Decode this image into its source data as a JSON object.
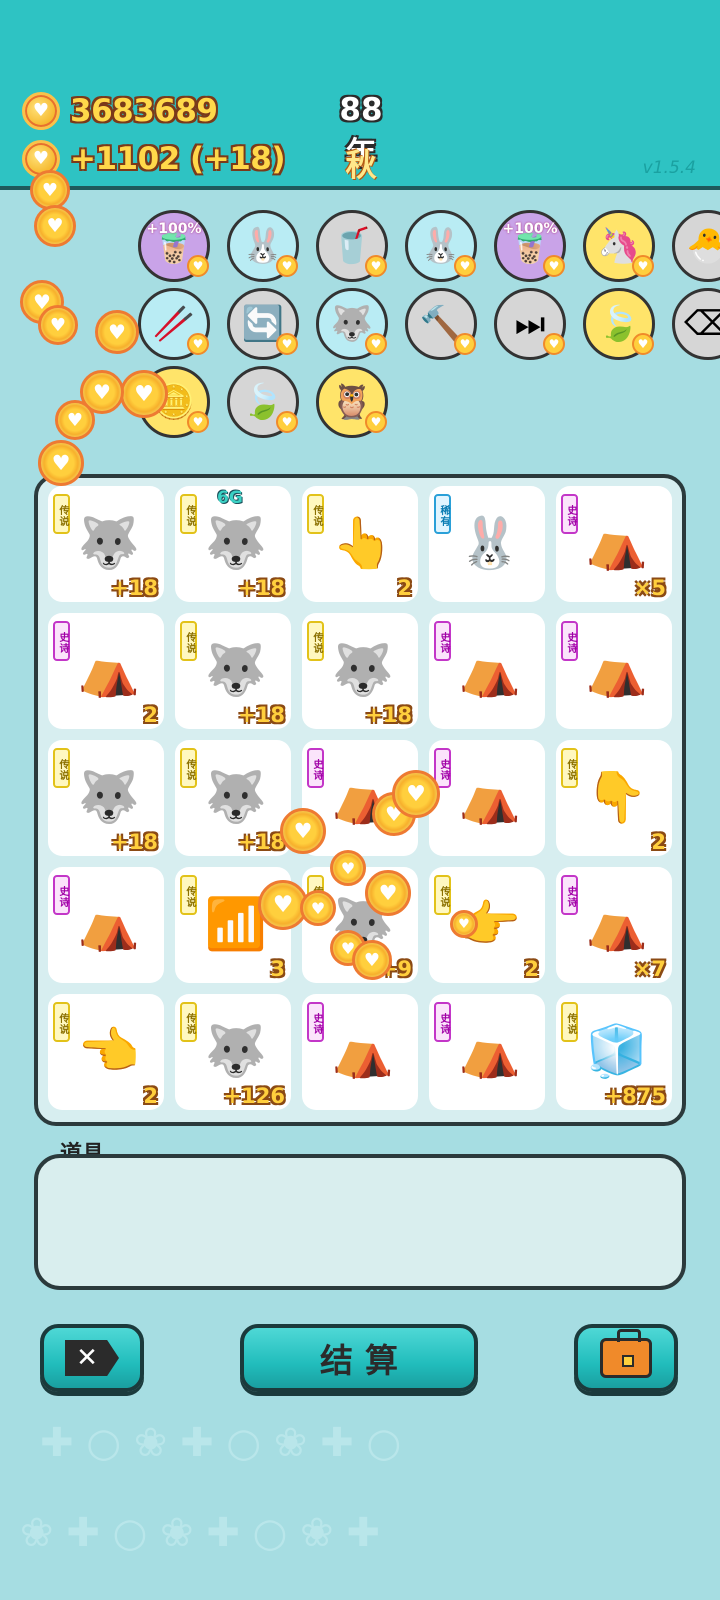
{
  "header": {
    "coins_total": "3683689",
    "income_rate": "+1102 (+18)",
    "year": "88年",
    "season": "秋",
    "version": "v1.5.4"
  },
  "powerups": [
    {
      "name": "boba-tea-boost",
      "icon": "🧋",
      "tag": "+100%",
      "bg": "#c9a3e8"
    },
    {
      "name": "rabbit-buddy",
      "icon": "🐰",
      "bg": "#b9ecf4"
    },
    {
      "name": "bubble-tea-cup",
      "icon": "🥤",
      "bg": "#d6d6d6"
    },
    {
      "name": "rabbit-buddy-2",
      "icon": "🐰",
      "bg": "#b9ecf4"
    },
    {
      "name": "boba-tea-boost-2",
      "icon": "🧋",
      "tag": "+100%",
      "bg": "#c9a3e8"
    },
    {
      "name": "unicorn",
      "icon": "🦄",
      "bg": "#ffe46a"
    },
    {
      "name": "chick-egg",
      "icon": "🐣",
      "bg": "#d6d6d6"
    },
    {
      "name": "chopsticks",
      "icon": "🥢",
      "bg": "#b9ecf4"
    },
    {
      "name": "refresh",
      "icon": "🔄",
      "bg": "#d6d6d6"
    },
    {
      "name": "husky-small",
      "icon": "🐺",
      "bg": "#b9ecf4"
    },
    {
      "name": "hammer",
      "icon": "🔨",
      "bg": "#d6d6d6"
    },
    {
      "name": "skip",
      "icon": "⏭",
      "bg": "#d6d6d6"
    },
    {
      "name": "leaf",
      "icon": "🍃",
      "bg": "#ffe46a"
    },
    {
      "name": "delete-tag",
      "icon": "⌫",
      "bg": "#d6d6d6"
    },
    {
      "name": "gold-coin-boost",
      "icon": "🪙",
      "bg": "#ffe46a"
    },
    {
      "name": "leaf-2",
      "icon": "🍃",
      "bg": "#d6d6d6"
    },
    {
      "name": "owl-glasses",
      "icon": "🦉",
      "bg": "#ffe46a"
    }
  ],
  "board": [
    {
      "rarity": "legend",
      "badge": "传说",
      "sprite": "🐺",
      "bonus": "+18"
    },
    {
      "rarity": "legend",
      "badge": "传说",
      "sprite": "🐺",
      "bonus": "+18",
      "net": "6G"
    },
    {
      "rarity": "legend",
      "badge": "传说",
      "sprite": "👆",
      "bonus": "2"
    },
    {
      "rarity": "rare",
      "badge": "稀有",
      "sprite": "🐰",
      "bonus": ""
    },
    {
      "rarity": "epic",
      "badge": "史诗",
      "sprite": "⛺",
      "bonus": "×5"
    },
    {
      "rarity": "epic",
      "badge": "史诗",
      "sprite": "⛺",
      "bonus": "2"
    },
    {
      "rarity": "legend",
      "badge": "传说",
      "sprite": "🐺",
      "bonus": "+18"
    },
    {
      "rarity": "legend",
      "badge": "传说",
      "sprite": "🐺",
      "bonus": "+18"
    },
    {
      "rarity": "epic",
      "badge": "史诗",
      "sprite": "⛺",
      "bonus": ""
    },
    {
      "rarity": "epic",
      "badge": "史诗",
      "sprite": "⛺",
      "bonus": ""
    },
    {
      "rarity": "legend",
      "badge": "传说",
      "sprite": "🐺",
      "bonus": "+18"
    },
    {
      "rarity": "legend",
      "badge": "传说",
      "sprite": "🐺",
      "bonus": "+18"
    },
    {
      "rarity": "epic",
      "badge": "史诗",
      "sprite": "⛺",
      "bonus": ""
    },
    {
      "rarity": "epic",
      "badge": "史诗",
      "sprite": "⛺",
      "bonus": ""
    },
    {
      "rarity": "legend",
      "badge": "传说",
      "sprite": "👇",
      "bonus": "2"
    },
    {
      "rarity": "epic",
      "badge": "史诗",
      "sprite": "⛺",
      "bonus": ""
    },
    {
      "rarity": "legend",
      "badge": "传说",
      "sprite": "📶",
      "bonus": "3"
    },
    {
      "rarity": "legend",
      "badge": "传说",
      "sprite": "🐺",
      "bonus": "+9"
    },
    {
      "rarity": "legend",
      "badge": "传说",
      "sprite": "👉",
      "bonus": "2"
    },
    {
      "rarity": "epic",
      "badge": "史诗",
      "sprite": "⛺",
      "bonus": "×7"
    },
    {
      "rarity": "legend",
      "badge": "传说",
      "sprite": "👈",
      "bonus": "2"
    },
    {
      "rarity": "legend",
      "badge": "传说",
      "sprite": "🐺",
      "bonus": "+126"
    },
    {
      "rarity": "epic",
      "badge": "史诗",
      "sprite": "⛺",
      "bonus": ""
    },
    {
      "rarity": "epic",
      "badge": "史诗",
      "sprite": "⛺",
      "bonus": ""
    },
    {
      "rarity": "legend",
      "badge": "传说",
      "sprite": "🧊",
      "bonus": "+875"
    }
  ],
  "props": {
    "label": "道具"
  },
  "buttons": {
    "settle": "结算"
  }
}
